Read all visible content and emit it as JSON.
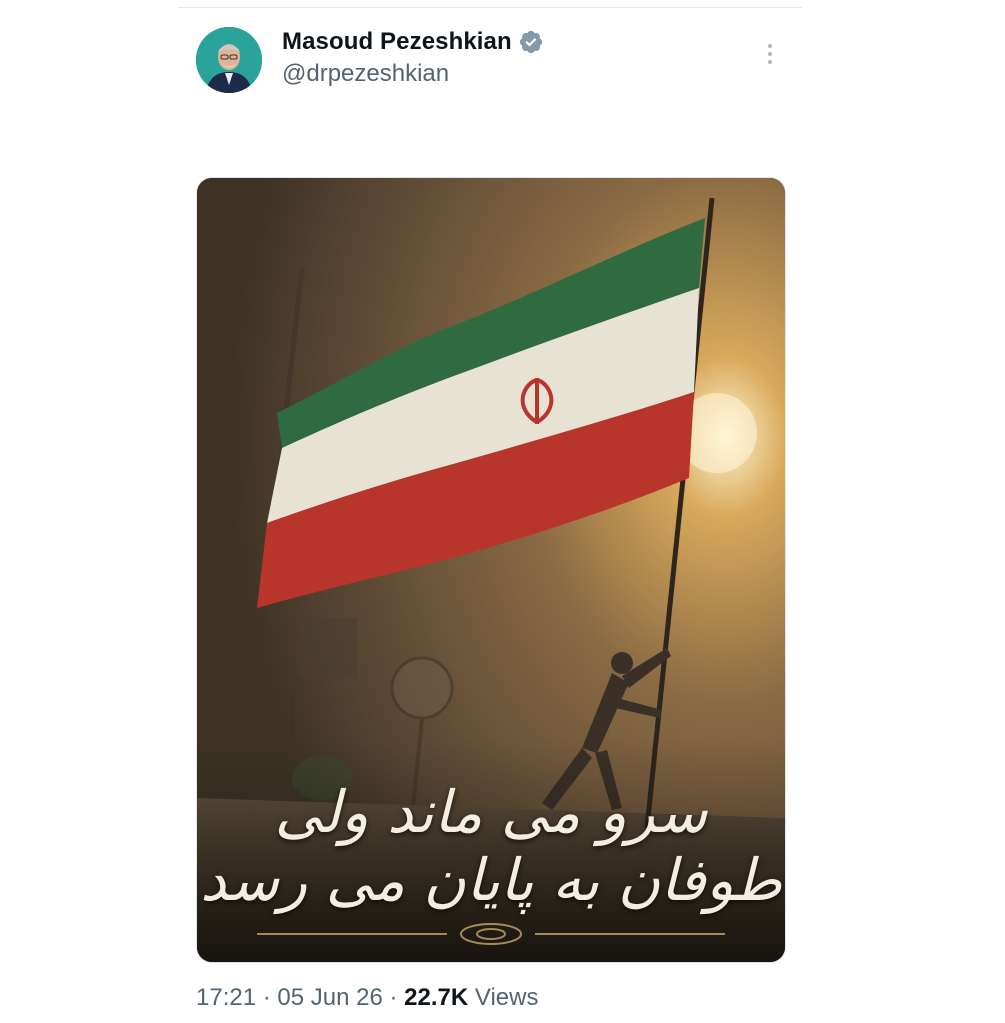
{
  "tweet": {
    "author": {
      "display_name": "Masoud Pezeshkian",
      "handle": "@drpezeshkian",
      "verified": true,
      "verified_icon": "verified-badge-icon",
      "avatar_icon": "avatar"
    },
    "menu_icon": "more-options-icon",
    "media": {
      "caption_text": "سرو می ماند ولی طوفان به پایان می رسد",
      "flag_colors": {
        "green": "#2f6b3e",
        "white": "#e8e2d4",
        "red": "#b8352b",
        "emblem": "#b8352b"
      }
    },
    "meta": {
      "time": "17:21",
      "separator": "·",
      "date": "05 Jun 26",
      "views_count": "22.7K",
      "views_label": "Views"
    }
  },
  "colors": {
    "primary_text": "#0f1419",
    "secondary_text": "#536471",
    "verified_badge": "#829aab",
    "background": "#ffffff"
  }
}
